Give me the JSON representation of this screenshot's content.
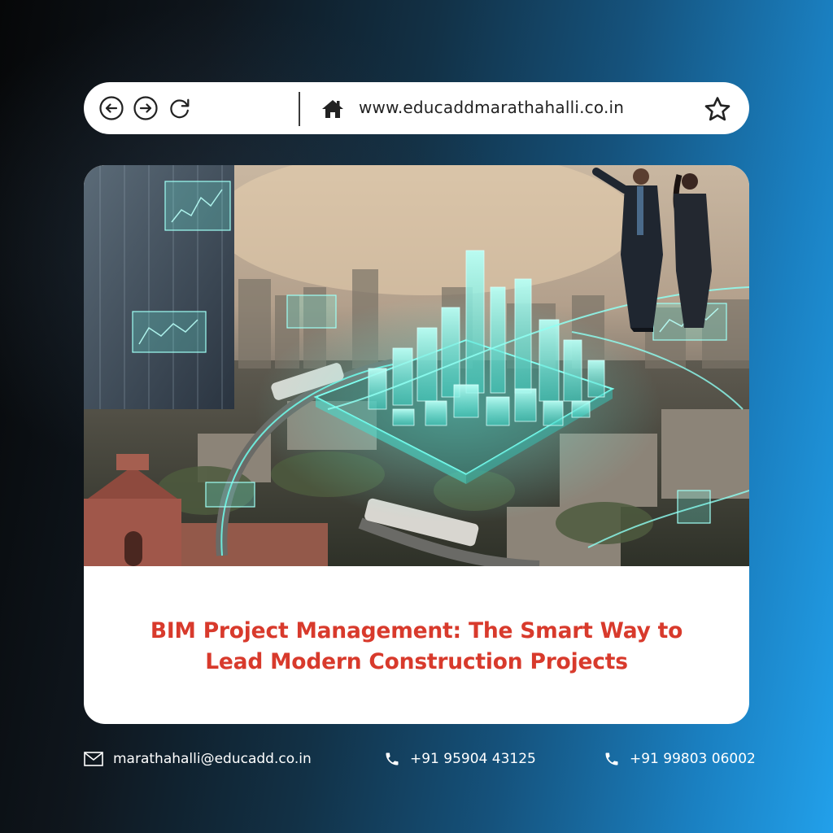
{
  "browser": {
    "url": "www.educaddmarathahalli.co.in",
    "icons": [
      "back-arrow-icon",
      "forward-arrow-icon",
      "reload-icon",
      "home-icon",
      "bookmark-star-icon"
    ]
  },
  "card": {
    "headline_line1": "BIM Project Management: The Smart Way to",
    "headline_line2": "Lead Modern Construction Projects",
    "headline_color": "#d83a2c"
  },
  "contact": {
    "email": "marathahalli@educadd.co.in",
    "phone1": "+91 95904 43125",
    "phone2": "+91 99803 06002",
    "icons": [
      "mail-icon",
      "phone-icon",
      "phone-icon"
    ]
  },
  "colors": {
    "background_dark": "#060708",
    "background_blue": "#22a0ea",
    "hologram": "#5ff5e6"
  }
}
